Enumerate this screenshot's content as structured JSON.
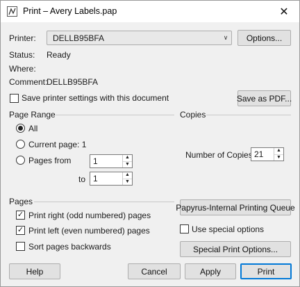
{
  "window": {
    "title": "Print – Avery Labels.pap",
    "close_glyph": "✕"
  },
  "printer": {
    "label": "Printer:",
    "selected": "DELLB95BFA",
    "options_button": "Options...",
    "status_label": "Status:",
    "status_value": "Ready",
    "where_label": "Where:",
    "where_value": "",
    "comment_label": "Comment:",
    "comment_value": "DELLB95BFA",
    "save_settings_label": "Save printer settings with this document",
    "save_settings_checked": false,
    "save_pdf_button": "Save as PDF..."
  },
  "page_range": {
    "title": "Page Range",
    "all_label": "All",
    "current_label": "Current page: 1",
    "pages_from_label": "Pages from",
    "from_value": "1",
    "to_label": "to",
    "to_value": "1",
    "selected": "all"
  },
  "copies": {
    "title": "Copies",
    "number_label": "Number of Copies",
    "number_value": "21"
  },
  "pages": {
    "title": "Pages",
    "odd_label": "Print right (odd numbered) pages",
    "odd_checked": true,
    "even_label": "Print left (even numbered) pages",
    "even_checked": true,
    "backwards_label": "Sort pages backwards",
    "backwards_checked": false
  },
  "queue_button": "Papyrus-Internal Printing Queue",
  "special_options_label": "Use special options",
  "special_options_checked": false,
  "special_print_button": "Special Print Options...",
  "footer": {
    "help": "Help",
    "cancel": "Cancel",
    "apply": "Apply",
    "print": "Print"
  },
  "glyphs": {
    "check": "✓",
    "spin_up": "▲",
    "spin_down": "▼",
    "combo_arrow": "∨"
  }
}
